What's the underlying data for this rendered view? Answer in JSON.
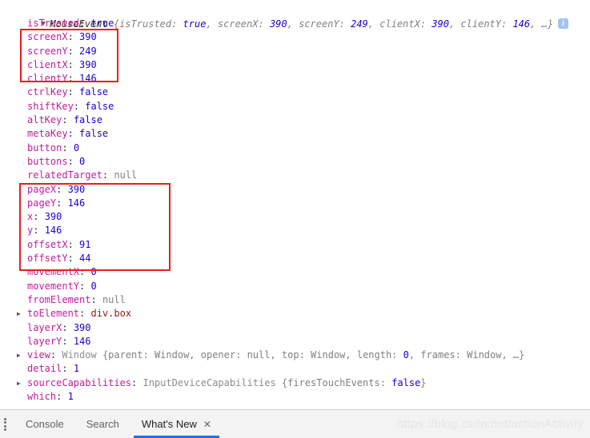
{
  "console": {
    "header": {
      "expander": "▼",
      "object_name": "MouseEvent",
      "preview_open": " {",
      "preview_tokens": [
        {
          "text": "isTrusted: ",
          "kind": "grey"
        },
        {
          "text": "true",
          "kind": "bool"
        },
        {
          "text": ", screenX: ",
          "kind": "grey"
        },
        {
          "text": "390",
          "kind": "num"
        },
        {
          "text": ", screenY: ",
          "kind": "grey"
        },
        {
          "text": "249",
          "kind": "num"
        },
        {
          "text": ", clientX: ",
          "kind": "grey"
        },
        {
          "text": "390",
          "kind": "num"
        },
        {
          "text": ", clientY: ",
          "kind": "grey"
        },
        {
          "text": "146",
          "kind": "num"
        },
        {
          "text": ", …}",
          "kind": "grey"
        }
      ],
      "badge_label": "i"
    },
    "properties": [
      {
        "expander": "",
        "name": "isTrusted",
        "value": "true",
        "value_kind": "bool"
      },
      {
        "expander": "",
        "name": "screenX",
        "value": "390",
        "value_kind": "num"
      },
      {
        "expander": "",
        "name": "screenY",
        "value": "249",
        "value_kind": "num"
      },
      {
        "expander": "",
        "name": "clientX",
        "value": "390",
        "value_kind": "num"
      },
      {
        "expander": "",
        "name": "clientY",
        "value": "146",
        "value_kind": "num"
      },
      {
        "expander": "",
        "name": "ctrlKey",
        "value": "false",
        "value_kind": "bool"
      },
      {
        "expander": "",
        "name": "shiftKey",
        "value": "false",
        "value_kind": "bool"
      },
      {
        "expander": "",
        "name": "altKey",
        "value": "false",
        "value_kind": "bool"
      },
      {
        "expander": "",
        "name": "metaKey",
        "value": "false",
        "value_kind": "bool"
      },
      {
        "expander": "",
        "name": "button",
        "value": "0",
        "value_kind": "num"
      },
      {
        "expander": "",
        "name": "buttons",
        "value": "0",
        "value_kind": "num"
      },
      {
        "expander": "",
        "name": "relatedTarget",
        "value": "null",
        "value_kind": "null"
      },
      {
        "expander": "",
        "name": "pageX",
        "value": "390",
        "value_kind": "num"
      },
      {
        "expander": "",
        "name": "pageY",
        "value": "146",
        "value_kind": "num"
      },
      {
        "expander": "",
        "name": "x",
        "value": "390",
        "value_kind": "num"
      },
      {
        "expander": "",
        "name": "y",
        "value": "146",
        "value_kind": "num"
      },
      {
        "expander": "",
        "name": "offsetX",
        "value": "91",
        "value_kind": "num"
      },
      {
        "expander": "",
        "name": "offsetY",
        "value": "44",
        "value_kind": "num"
      },
      {
        "expander": "",
        "name": "movementX",
        "value": "0",
        "value_kind": "num"
      },
      {
        "expander": "",
        "name": "movementY",
        "value": "0",
        "value_kind": "num"
      },
      {
        "expander": "",
        "name": "fromElement",
        "value": "null",
        "value_kind": "null"
      },
      {
        "expander": "▶",
        "name": "toElement",
        "value": "div.box",
        "value_kind": "classname"
      },
      {
        "expander": "",
        "name": "layerX",
        "value": "390",
        "value_kind": "num"
      },
      {
        "expander": "",
        "name": "layerY",
        "value": "146",
        "value_kind": "num"
      },
      {
        "expander": "▶",
        "name": "view",
        "value": "",
        "value_kind": "tokens",
        "tokens": [
          {
            "text": "Window ",
            "kind": "objgrey"
          },
          {
            "text": "{parent: Window, opener: ",
            "kind": "grey"
          },
          {
            "text": "null",
            "kind": "grey"
          },
          {
            "text": ", top: Window, length: ",
            "kind": "grey"
          },
          {
            "text": "0",
            "kind": "num"
          },
          {
            "text": ", frames: Window, …}",
            "kind": "grey"
          }
        ]
      },
      {
        "expander": "",
        "name": "detail",
        "value": "1",
        "value_kind": "num"
      },
      {
        "expander": "▶",
        "name": "sourceCapabilities",
        "value": "",
        "value_kind": "tokens",
        "tokens": [
          {
            "text": "InputDeviceCapabilities ",
            "kind": "objgrey"
          },
          {
            "text": "{firesTouchEvents: ",
            "kind": "grey"
          },
          {
            "text": "false",
            "kind": "bool"
          },
          {
            "text": "}",
            "kind": "grey"
          }
        ]
      },
      {
        "expander": "",
        "name": "which",
        "value": "1",
        "value_kind": "num"
      }
    ],
    "annotations": [
      {
        "label": "coordinate-highlight-screen-client"
      },
      {
        "label": "coordinate-highlight-page-offset"
      }
    ]
  },
  "drawer": {
    "tabs": [
      {
        "label": "Console",
        "active": false,
        "closable": false
      },
      {
        "label": "Search",
        "active": false,
        "closable": false
      },
      {
        "label": "What's New",
        "active": true,
        "closable": true,
        "close_glyph": "✕"
      }
    ]
  },
  "watermark": {
    "text": "https://blog.csdn.net/actionActivity"
  },
  "colors": {
    "property_name": "#c41a9e",
    "value_number": "#1c00cf",
    "value_null": "#808080",
    "classname": "#8b1a1a",
    "annotation_red": "#e81f1f",
    "tab_active_underline": "#1a73e8",
    "badge_bg": "#a3c2f0"
  }
}
